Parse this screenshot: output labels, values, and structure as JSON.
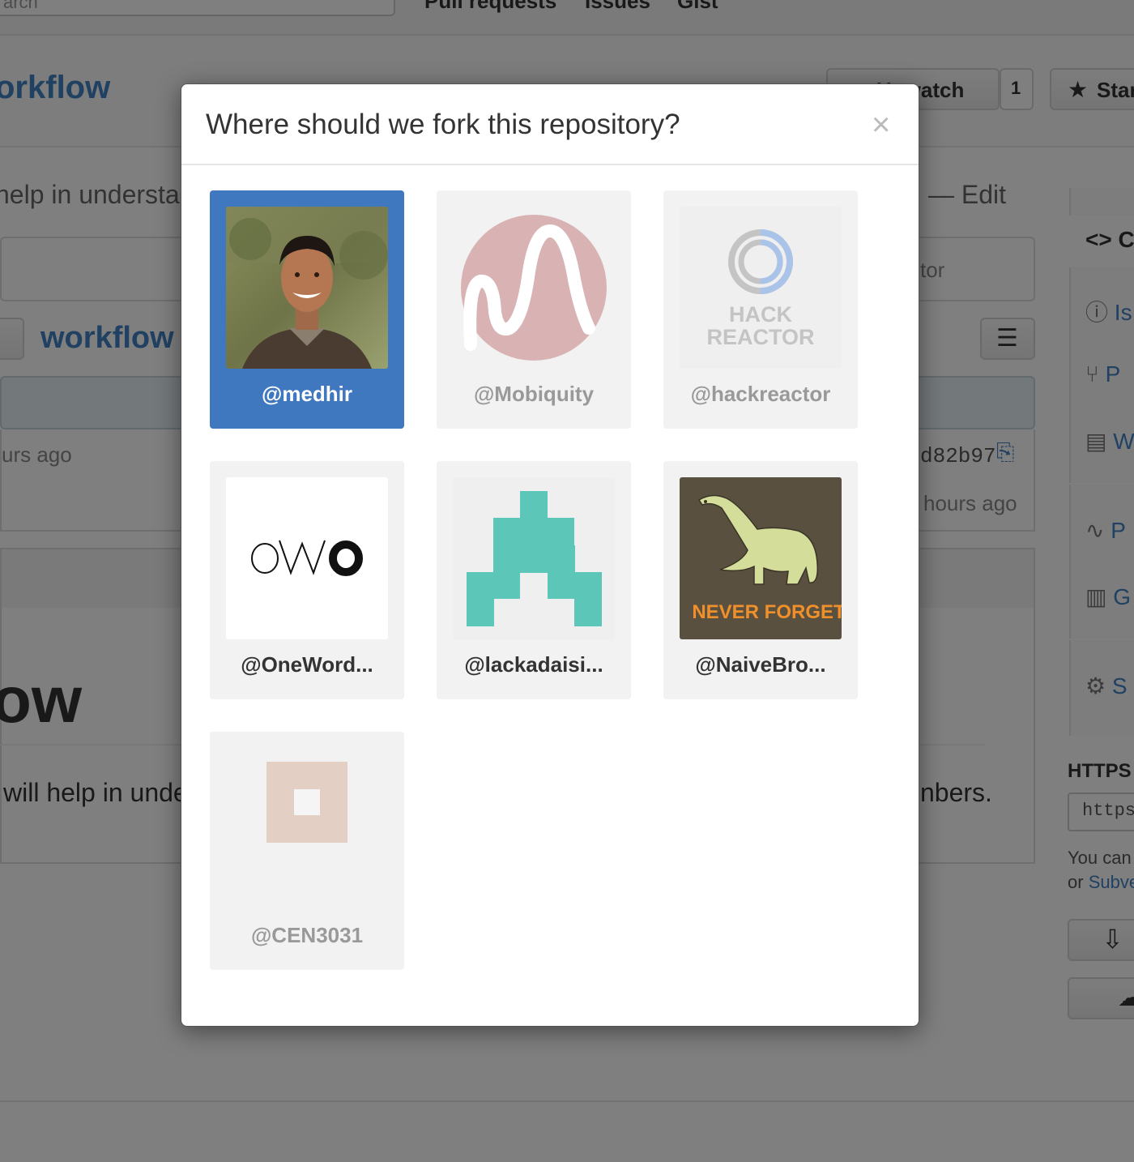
{
  "background": {
    "search_placeholder": "arch",
    "nav": [
      "Pull requests",
      "Issues",
      "Gist"
    ],
    "repo_name": "orkflow",
    "watch_label": "Unwatch",
    "watch_count": "1",
    "star_label": "Star",
    "description": "help in understa",
    "edit_label": "— Edit",
    "contributor_text": "tor",
    "branch_path": "workflow /",
    "commit_time": "urs ago",
    "commit_sha": "d82b97",
    "row_time": "hours ago",
    "readme_heading": "ow",
    "readme_text_left": "will help in unde",
    "readme_text_right": "nbers.",
    "sidebar": {
      "code": "C",
      "issues": "Is",
      "pulls": "P",
      "wiki": "W",
      "pulse": "P",
      "graphs": "G",
      "settings": "S"
    },
    "https_label": "HTTPS c",
    "https_value": "https",
    "hint_line1": "You can",
    "hint_line2_prefix": "or ",
    "hint_line2_link": "Subve"
  },
  "modal": {
    "title": "Where should we fork this repository?",
    "close_glyph": "×",
    "tiles": [
      {
        "label": "@medhir",
        "state": "selected",
        "avatar": "person-photo"
      },
      {
        "label": "@Mobiquity",
        "state": "disabled",
        "avatar": "mobiquity-logo"
      },
      {
        "label": "@hackreactor",
        "state": "disabled",
        "avatar": "hack-reactor-logo",
        "logo_text_1": "HACK",
        "logo_text_2": "REACTOR"
      },
      {
        "label": "@OneWord...",
        "state": "available",
        "avatar": "owo-logo"
      },
      {
        "label": "@lackadaisi...",
        "state": "available",
        "avatar": "identicon-teal"
      },
      {
        "label": "@NaiveBro...",
        "state": "available",
        "avatar": "dinosaur-poster",
        "logo_text_1": "NEVER FORGET"
      },
      {
        "label": "@CEN3031",
        "state": "disabled",
        "avatar": "identicon-beige"
      }
    ]
  },
  "colors": {
    "selected_tile": "#4078c0",
    "link": "#4183c4",
    "identicon_teal": "#5cc6b8",
    "identicon_beige": "#e3cfc3",
    "mobiquity_pink": "#d9b3b4",
    "dino_bg": "#5a5040",
    "dino_text": "#f0902a"
  }
}
